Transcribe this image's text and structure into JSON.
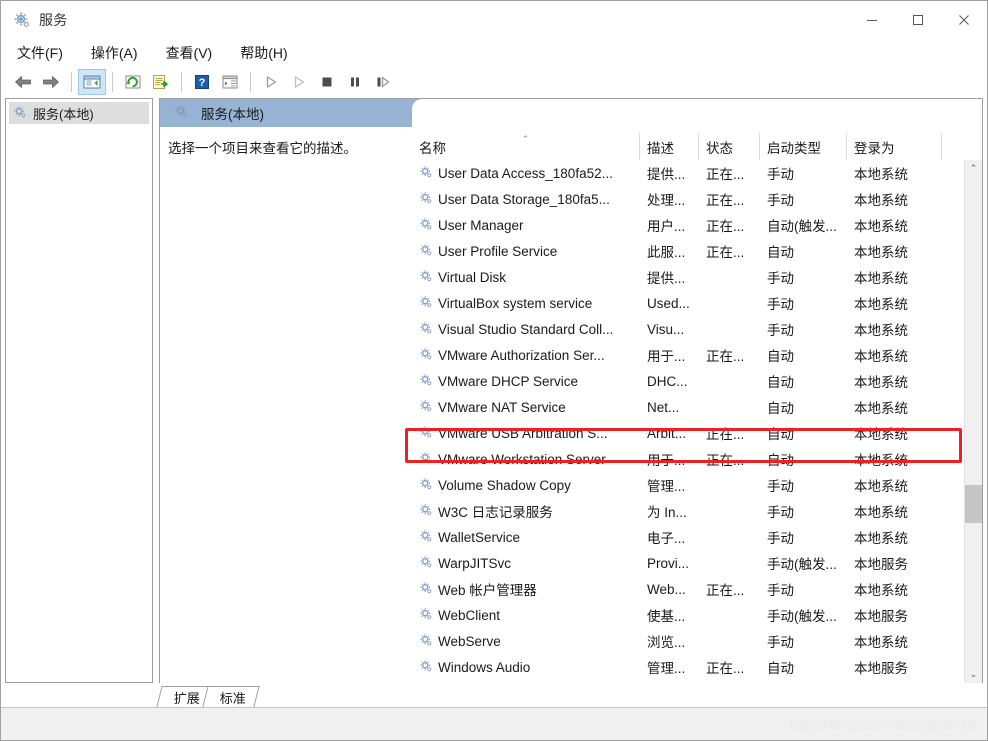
{
  "window": {
    "title": "服务",
    "icon": "services-gear-icon",
    "controls": {
      "minimize": "最小化",
      "maximize": "最大化",
      "close": "关闭"
    }
  },
  "menubar": {
    "items": [
      {
        "label": "文件(F)",
        "name": "menu-file"
      },
      {
        "label": "操作(A)",
        "name": "menu-action"
      },
      {
        "label": "查看(V)",
        "name": "menu-view"
      },
      {
        "label": "帮助(H)",
        "name": "menu-help"
      }
    ]
  },
  "toolbar": {
    "buttons": [
      {
        "name": "back-icon",
        "title": "后退"
      },
      {
        "name": "forward-icon",
        "title": "前进"
      },
      {
        "name": "show-hide-console-tree-icon",
        "title": "显示/隐藏控制台树",
        "active": true
      },
      {
        "name": "refresh-icon",
        "title": "刷新"
      },
      {
        "name": "export-list-icon",
        "title": "导出列表"
      },
      {
        "name": "help-icon",
        "title": "帮助"
      },
      {
        "name": "properties-icon",
        "title": "属性"
      },
      {
        "name": "start-service-icon",
        "title": "启动服务"
      },
      {
        "name": "resume-service-icon",
        "title": "继续服务"
      },
      {
        "name": "stop-service-icon",
        "title": "停止服务"
      },
      {
        "name": "pause-service-icon",
        "title": "暂停服务"
      },
      {
        "name": "restart-service-icon",
        "title": "重启服务"
      }
    ]
  },
  "tree": {
    "items": [
      {
        "label": "服务(本地)",
        "icon": "services-gear-icon",
        "selected": true
      }
    ]
  },
  "pane": {
    "header_title": "服务(本地)",
    "header_icon": "services-gear-icon",
    "description_placeholder": "选择一个项目来查看它的描述。"
  },
  "list": {
    "columns": [
      {
        "label": "名称",
        "key": "name",
        "sorted": "asc",
        "sort_caret": "⌃"
      },
      {
        "label": "描述",
        "key": "desc"
      },
      {
        "label": "状态",
        "key": "state"
      },
      {
        "label": "启动类型",
        "key": "start"
      },
      {
        "label": "登录为",
        "key": "logon"
      }
    ],
    "rows": [
      {
        "name": "User Data Access_180fa52...",
        "desc": "提供...",
        "state": "正在...",
        "start": "手动",
        "logon": "本地系统",
        "highlighted": false
      },
      {
        "name": "User Data Storage_180fa5...",
        "desc": "处理...",
        "state": "正在...",
        "start": "手动",
        "logon": "本地系统",
        "highlighted": false
      },
      {
        "name": "User Manager",
        "desc": "用户...",
        "state": "正在...",
        "start": "自动(触发...",
        "logon": "本地系统",
        "highlighted": false
      },
      {
        "name": "User Profile Service",
        "desc": "此服...",
        "state": "正在...",
        "start": "自动",
        "logon": "本地系统",
        "highlighted": false
      },
      {
        "name": "Virtual Disk",
        "desc": "提供...",
        "state": "",
        "start": "手动",
        "logon": "本地系统",
        "highlighted": false
      },
      {
        "name": "VirtualBox system service",
        "desc": "Used...",
        "state": "",
        "start": "手动",
        "logon": "本地系统",
        "highlighted": false
      },
      {
        "name": "Visual Studio Standard Coll...",
        "desc": "Visu...",
        "state": "",
        "start": "手动",
        "logon": "本地系统",
        "highlighted": false
      },
      {
        "name": "VMware Authorization Ser...",
        "desc": "用于...",
        "state": "正在...",
        "start": "自动",
        "logon": "本地系统",
        "highlighted": false
      },
      {
        "name": "VMware DHCP Service",
        "desc": "DHC...",
        "state": "",
        "start": "自动",
        "logon": "本地系统",
        "highlighted": false
      },
      {
        "name": "VMware NAT Service",
        "desc": "Net...",
        "state": "",
        "start": "自动",
        "logon": "本地系统",
        "highlighted": false
      },
      {
        "name": "VMware USB Arbitration S...",
        "desc": "Arbit...",
        "state": "正在...",
        "start": "自动",
        "logon": "本地系统",
        "highlighted": true
      },
      {
        "name": "VMware Workstation Server",
        "desc": "用于...",
        "state": "正在...",
        "start": "自动",
        "logon": "本地系统",
        "highlighted": false
      },
      {
        "name": "Volume Shadow Copy",
        "desc": "管理...",
        "state": "",
        "start": "手动",
        "logon": "本地系统",
        "highlighted": false
      },
      {
        "name": "W3C 日志记录服务",
        "desc": "为 In...",
        "state": "",
        "start": "手动",
        "logon": "本地系统",
        "highlighted": false
      },
      {
        "name": "WalletService",
        "desc": "电子...",
        "state": "",
        "start": "手动",
        "logon": "本地系统",
        "highlighted": false
      },
      {
        "name": "WarpJITSvc",
        "desc": "Provi...",
        "state": "",
        "start": "手动(触发...",
        "logon": "本地服务",
        "highlighted": false
      },
      {
        "name": "Web 帐户管理器",
        "desc": "Web...",
        "state": "正在...",
        "start": "手动",
        "logon": "本地系统",
        "highlighted": false
      },
      {
        "name": "WebClient",
        "desc": "使基...",
        "state": "",
        "start": "手动(触发...",
        "logon": "本地服务",
        "highlighted": false
      },
      {
        "name": "WebServe",
        "desc": "浏览...",
        "state": "",
        "start": "手动",
        "logon": "本地系统",
        "highlighted": false
      },
      {
        "name": "Windows Audio",
        "desc": "管理...",
        "state": "正在...",
        "start": "自动",
        "logon": "本地服务",
        "highlighted": false
      }
    ],
    "scrollbar": {
      "up_arrow": "⌃",
      "down_arrow": "⌄"
    }
  },
  "tabs": [
    {
      "label": "扩展",
      "name": "tab-extended",
      "selected": false
    },
    {
      "label": "标准",
      "name": "tab-standard",
      "selected": true
    }
  ],
  "statusbar": {
    "text": ""
  },
  "watermark": {
    "text": "https://blog.csdn.net/ssj925319"
  },
  "colors": {
    "header_blue": "#96b3d4",
    "annotation_red": "#ef2020",
    "toolbar_active": "#cfe6f7",
    "tree_selection": "#dedede"
  }
}
